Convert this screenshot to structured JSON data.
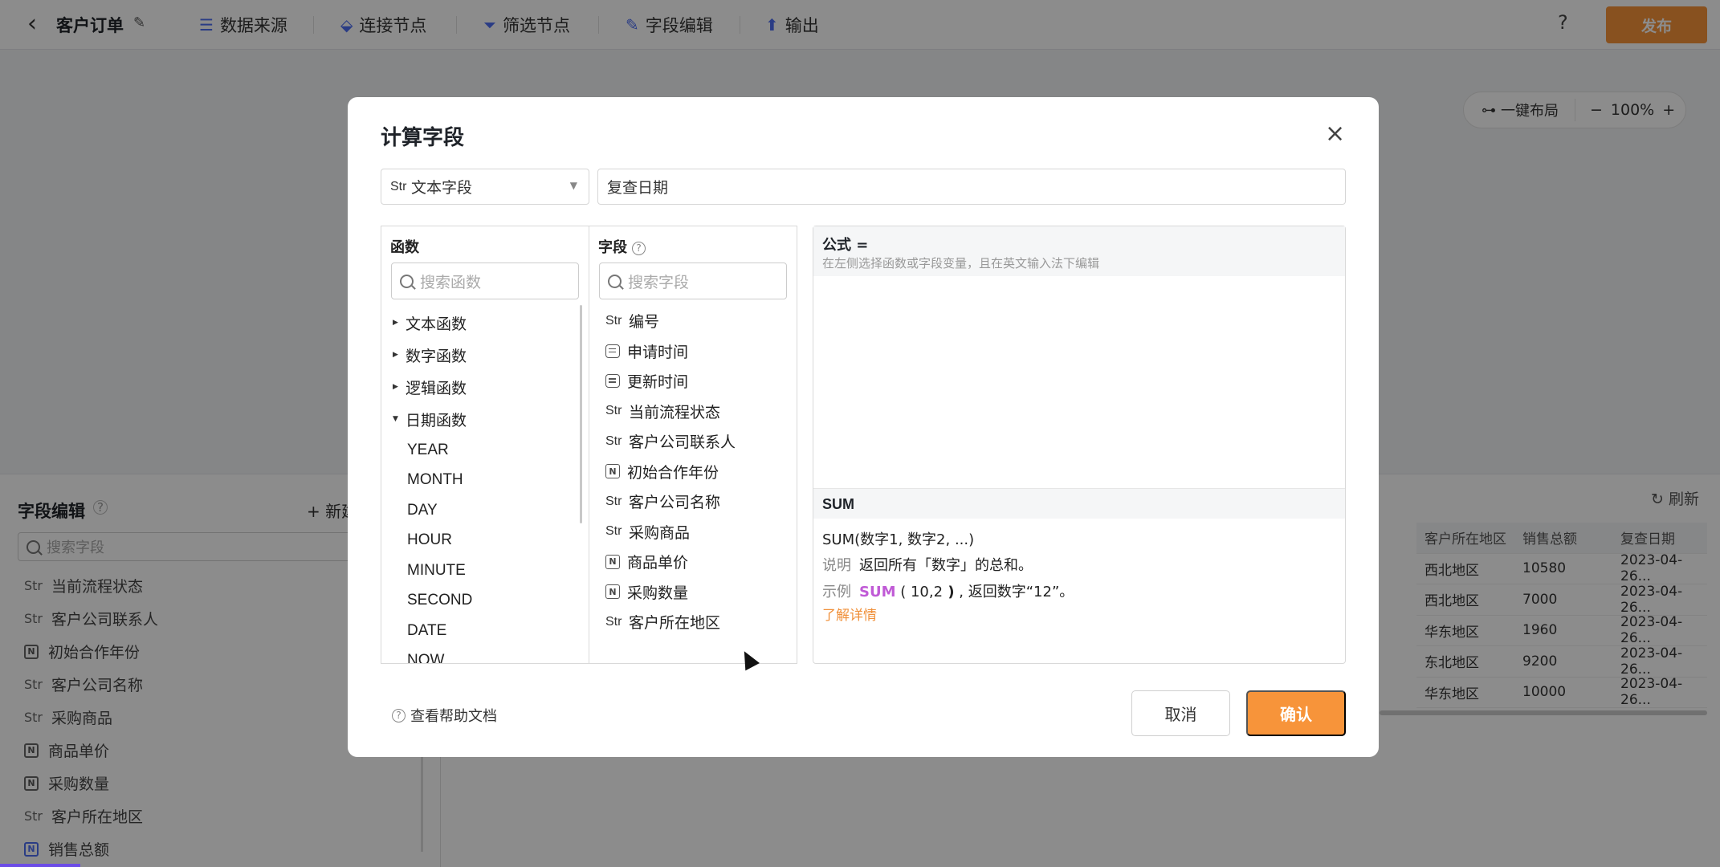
{
  "topbar": {
    "title": "客户订单",
    "items": [
      {
        "label": "数据来源",
        "icon": "database-icon"
      },
      {
        "label": "连接节点",
        "icon": "link-node-icon"
      },
      {
        "label": "筛选节点",
        "icon": "filter-icon"
      },
      {
        "label": "字段编辑",
        "icon": "pencil-icon"
      },
      {
        "label": "输出",
        "icon": "export-icon"
      }
    ],
    "help": "?",
    "publish_label": "发布"
  },
  "canvas": {
    "layout_label": "一键布局",
    "zoom": "100%"
  },
  "bottom_panel": {
    "title": "字段编辑",
    "new_label": "+ 新建",
    "search_placeholder": "搜索字段",
    "fields": [
      {
        "type": "Str",
        "label": "当前流程状态"
      },
      {
        "type": "Str",
        "label": "客户公司联系人"
      },
      {
        "type": "N",
        "label": "初始合作年份"
      },
      {
        "type": "Str",
        "label": "客户公司名称"
      },
      {
        "type": "Str",
        "label": "采购商品"
      },
      {
        "type": "N",
        "label": "商品单价"
      },
      {
        "type": "N",
        "label": "采购数量"
      },
      {
        "type": "Str",
        "label": "客户所在地区"
      },
      {
        "type": "N",
        "label": "销售总额"
      }
    ],
    "refresh_label": "刷新",
    "table": {
      "columns": [
        "客户所在地区",
        "销售总额",
        "复查日期"
      ],
      "rows": [
        [
          "西北地区",
          "10580",
          "2023-04-26..."
        ],
        [
          "西北地区",
          "7000",
          "2023-04-26..."
        ],
        [
          "华东地区",
          "1960",
          "2023-04-26..."
        ],
        [
          "东北地区",
          "9200",
          "2023-04-26..."
        ],
        [
          "华东地区",
          "10000",
          "2023-04-26..."
        ]
      ]
    }
  },
  "modal": {
    "title": "计算字段",
    "type_prefix": "Str",
    "type_value": "文本字段",
    "name_value": "复查日期",
    "functions": {
      "label": "函数",
      "search_placeholder": "搜索函数",
      "categories": [
        {
          "label": "文本函数",
          "expanded": false
        },
        {
          "label": "数字函数",
          "expanded": false
        },
        {
          "label": "逻辑函数",
          "expanded": false
        },
        {
          "label": "日期函数",
          "expanded": true
        }
      ],
      "date_functions": [
        "YEAR",
        "MONTH",
        "DAY",
        "HOUR",
        "MINUTE",
        "SECOND",
        "DATE",
        "NOW"
      ]
    },
    "fields": {
      "label": "字段",
      "search_placeholder": "搜索字段",
      "items": [
        {
          "type": "Str",
          "label": "编号"
        },
        {
          "type": "Date",
          "label": "申请时间"
        },
        {
          "type": "Date",
          "label": "更新时间"
        },
        {
          "type": "Str",
          "label": "当前流程状态"
        },
        {
          "type": "Str",
          "label": "客户公司联系人"
        },
        {
          "type": "N",
          "label": "初始合作年份"
        },
        {
          "type": "Str",
          "label": "客户公司名称"
        },
        {
          "type": "Str",
          "label": "采购商品"
        },
        {
          "type": "N",
          "label": "商品单价"
        },
        {
          "type": "N",
          "label": "采购数量"
        },
        {
          "type": "Str",
          "label": "客户所在地区"
        }
      ]
    },
    "formula": {
      "label": "公式 =",
      "hint": "在左侧选择函数或字段变量，且在英文输入法下编辑",
      "value": ""
    },
    "doc": {
      "name": "SUM",
      "signature": "SUM(数字1, 数字2, ...)",
      "desc_label": "说明",
      "desc": "返回所有「数字」的总和。",
      "example_label": "示例",
      "example_kw": "SUM",
      "example_open": " ( ",
      "example_args": "10,2",
      "example_close": " )",
      "example_result": " , 返回数字“12”。",
      "more_link": "了解详情"
    },
    "help_doc_label": "查看帮助文档",
    "cancel_label": "取消",
    "ok_label": "确认"
  },
  "colors": {
    "accent": "#f7943a",
    "keyword": "#c05ad6",
    "icon_blue": "#4e6ef2"
  }
}
